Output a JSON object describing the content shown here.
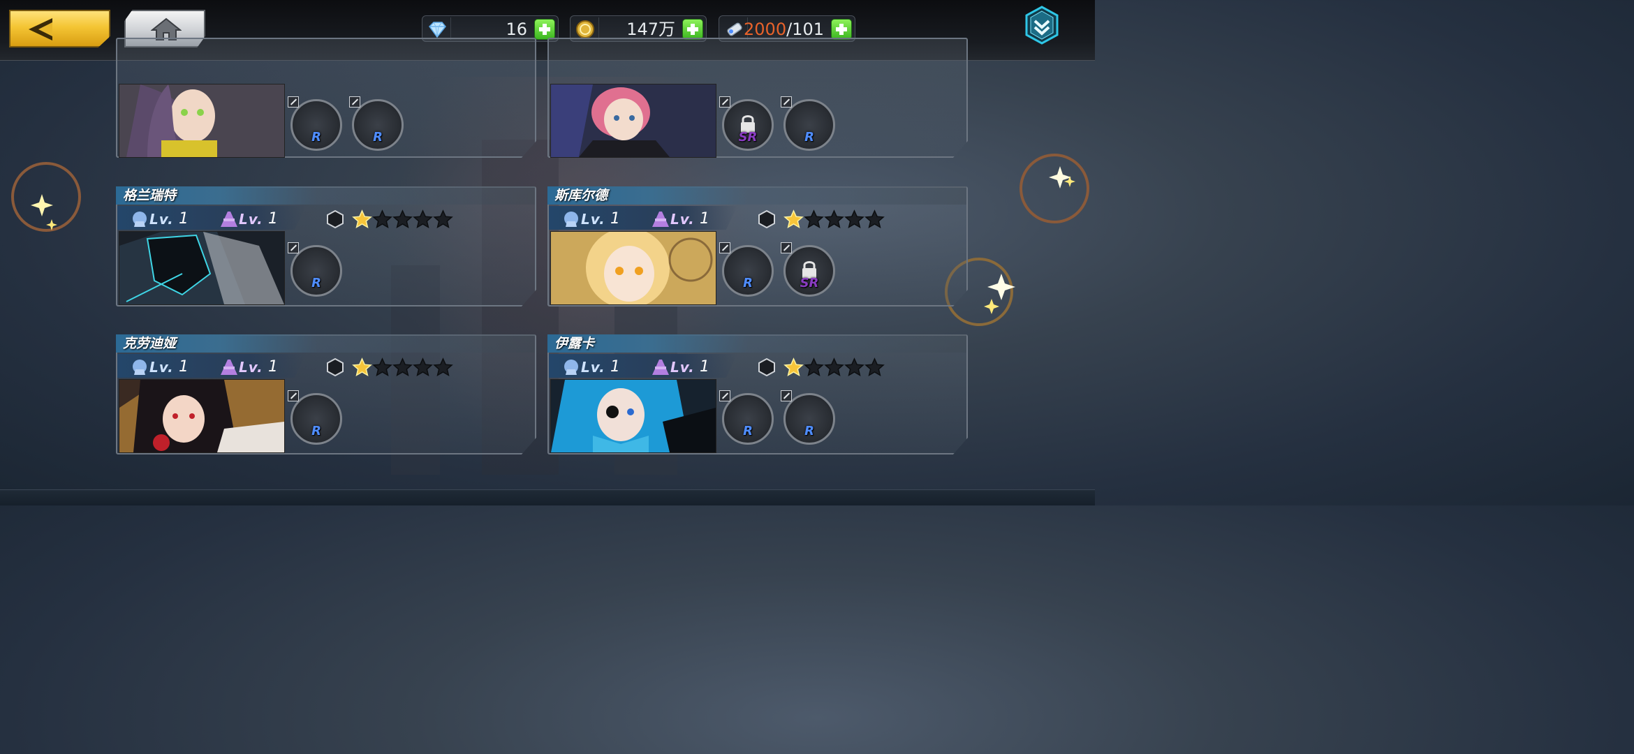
{
  "top_bar": {
    "back_icon": "back-arrow-icon",
    "home_icon": "home-icon",
    "resources": [
      {
        "icon": "diamond-icon",
        "value": "16"
      },
      {
        "icon": "gold-coin-icon",
        "value": "147万"
      },
      {
        "icon": "stamina-icon",
        "value_current": "2000",
        "value_sep_max": "/101"
      }
    ],
    "menu_icon": "chevron-down-shield-icon"
  },
  "colors": {
    "accent_gold": "#f4c534",
    "plus_green": "#3cb620",
    "stamina_current": "#e8622a",
    "rarity_r": "#4f8dff",
    "rarity_sr": "#8a3cc2"
  },
  "lv_text": "Lv.",
  "cards": [
    {
      "name": "",
      "lv1": "",
      "lv2": "",
      "stars": 0,
      "weapons": [
        {
          "rarity": "R",
          "locked": false
        },
        {
          "rarity": "R",
          "locked": false
        }
      ]
    },
    {
      "name": "",
      "lv1": "",
      "lv2": "",
      "stars": 0,
      "weapons": [
        {
          "rarity": "SR",
          "locked": true
        },
        {
          "rarity": "R",
          "locked": false
        }
      ]
    },
    {
      "name": "格兰瑞特",
      "lv1": "1",
      "lv2": "1",
      "stars": 1,
      "max_stars": 5,
      "weapons": [
        {
          "rarity": "R",
          "locked": false
        }
      ]
    },
    {
      "name": "斯库尔德",
      "lv1": "1",
      "lv2": "1",
      "stars": 1,
      "max_stars": 5,
      "weapons": [
        {
          "rarity": "R",
          "locked": false
        },
        {
          "rarity": "SR",
          "locked": true
        }
      ]
    },
    {
      "name": "克劳迪娅",
      "lv1": "1",
      "lv2": "1",
      "stars": 1,
      "max_stars": 5,
      "weapons": [
        {
          "rarity": "R",
          "locked": false
        }
      ]
    },
    {
      "name": "伊露卡",
      "lv1": "1",
      "lv2": "1",
      "stars": 1,
      "max_stars": 5,
      "weapons": [
        {
          "rarity": "R",
          "locked": false
        },
        {
          "rarity": "R",
          "locked": false
        }
      ]
    }
  ]
}
